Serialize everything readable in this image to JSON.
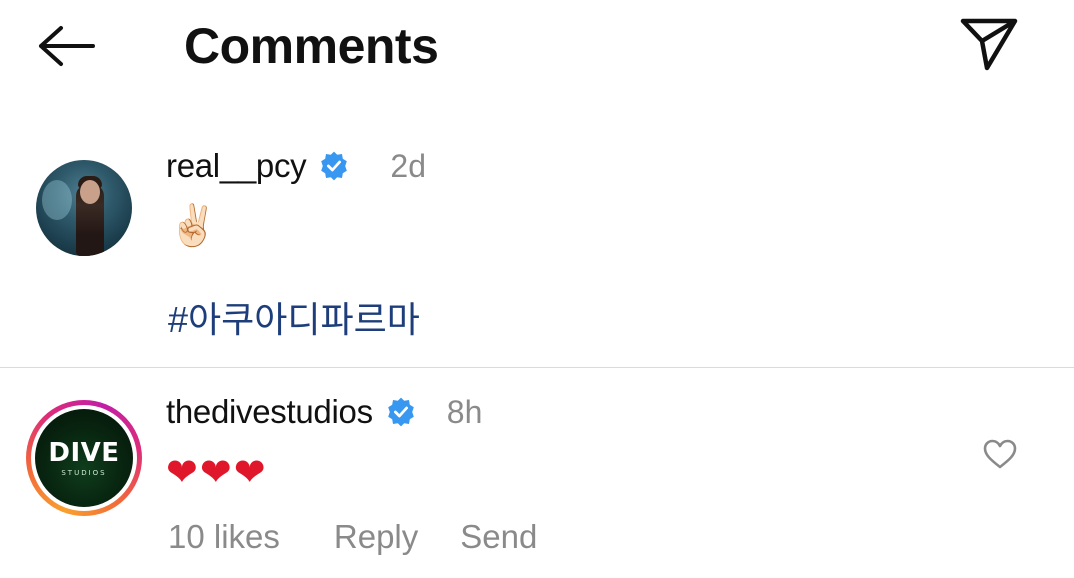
{
  "header": {
    "title": "Comments",
    "back_icon": "arrow-left-icon",
    "share_icon": "paper-plane-icon"
  },
  "caption": {
    "username": "real__pcy",
    "verified": true,
    "time": "2d",
    "emoji": "✌🏻",
    "hashtag": "#아쿠아디파르마"
  },
  "comments": [
    {
      "username": "thedivestudios",
      "verified": true,
      "time": "8h",
      "hearts": [
        "❤",
        "❤",
        "❤"
      ],
      "likes": "10 likes",
      "reply_label": "Reply",
      "send_label": "Send",
      "avatar_text": "DIVE",
      "avatar_subtext": "STUDIOS"
    }
  ],
  "colors": {
    "verified_blue": "#3897f0",
    "hashtag": "#1d3e7a",
    "muted": "#8a8a8a",
    "heart_red": "#e0162b"
  }
}
